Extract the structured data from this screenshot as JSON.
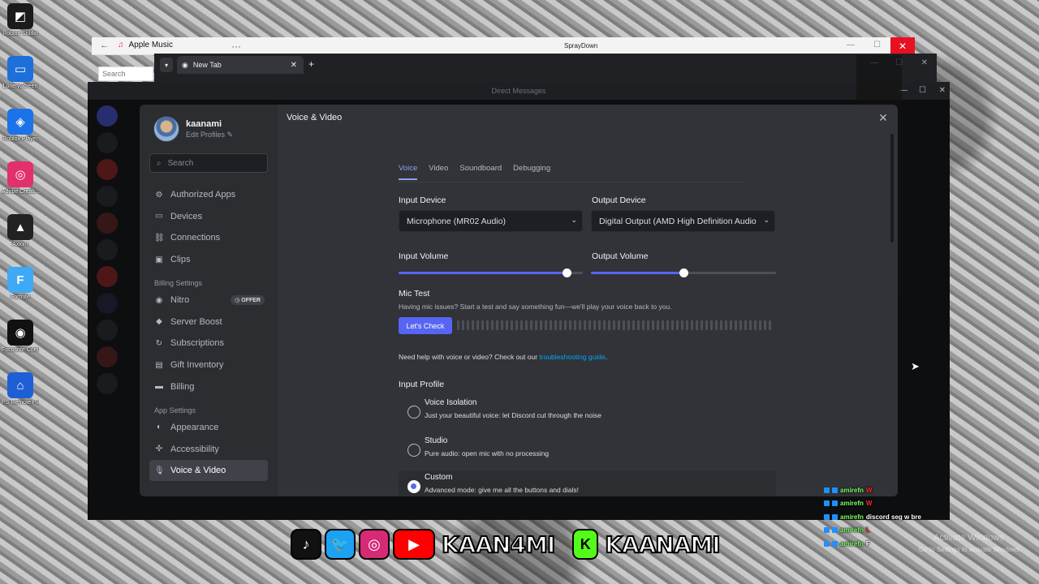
{
  "desktop": {
    "icons": [
      {
        "label": "Roblox Studio",
        "color": "#1b1b1b",
        "glyph": "◩"
      },
      {
        "label": "LonelyScreen",
        "color": "#1e6fd9",
        "glyph": "▭"
      },
      {
        "label": "Roblox Player",
        "color": "#1a73e8",
        "glyph": "◈"
      },
      {
        "label": "Adobe Creati...",
        "color": "#e1306c",
        "glyph": "◎"
      },
      {
        "label": "Axiom",
        "color": "#222222",
        "glyph": "▲"
      },
      {
        "label": "Fortnite",
        "color": "#3fa9f5",
        "glyph": "F"
      },
      {
        "label": "Focusrite Control",
        "color": "#111111",
        "glyph": "◉"
      },
      {
        "label": "PS Remote Play",
        "color": "#1f5fd6",
        "glyph": "⌂"
      }
    ]
  },
  "apple_music": {
    "title": "Apple Music",
    "search_placeholder": "Search",
    "center_text": "SprayDown"
  },
  "chrome": {
    "tab_label": "New Tab"
  },
  "discord": {
    "titlebar": "Direct Messages"
  },
  "settings": {
    "user": {
      "name": "kaanami",
      "edit": "Edit Profiles"
    },
    "search_placeholder": "Search",
    "nav_top": [
      {
        "label": "Authorized Apps",
        "icon": "⚙"
      },
      {
        "label": "Devices",
        "icon": "▭"
      },
      {
        "label": "Connections",
        "icon": "⛓"
      },
      {
        "label": "Clips",
        "icon": "▣"
      }
    ],
    "billing_head": "Billing Settings",
    "nav_billing": [
      {
        "label": "Nitro",
        "icon": "◉"
      },
      {
        "label": "Server Boost",
        "icon": "◆"
      },
      {
        "label": "Subscriptions",
        "icon": "↻"
      },
      {
        "label": "Gift Inventory",
        "icon": "▤"
      },
      {
        "label": "Billing",
        "icon": "▬"
      }
    ],
    "offer_badge": "OFFER",
    "app_head": "App Settings",
    "nav_app": [
      {
        "label": "Appearance",
        "icon": "◐"
      },
      {
        "label": "Accessibility",
        "icon": "✣"
      },
      {
        "label": "Voice & Video",
        "icon": "🎙"
      }
    ],
    "page_title": "Voice & Video",
    "tabs": [
      "Voice",
      "Video",
      "Soundboard",
      "Debugging"
    ],
    "input_device_label": "Input Device",
    "input_device_value": "Microphone (MR02 Audio)",
    "output_device_label": "Output Device",
    "output_device_value": "Digital Output (AMD High Definition Audio",
    "input_volume_label": "Input Volume",
    "input_volume": 0.91,
    "output_volume_label": "Output Volume",
    "output_volume": 0.5,
    "mic_test_title": "Mic Test",
    "mic_test_desc": "Having mic issues? Start a test and say something fun—we'll play your voice back to you.",
    "mic_test_button": "Let's Check",
    "help_text": "Need help with voice or video? Check out our ",
    "help_link": "troubleshooting guide",
    "help_end": ".",
    "input_profile_title": "Input Profile",
    "profiles": [
      {
        "title": "Voice Isolation",
        "sub": "Just your beautiful voice: let Discord cut through the noise"
      },
      {
        "title": "Studio",
        "sub": "Pure audio: open mic with no processing"
      },
      {
        "title": "Custom",
        "sub": "Advanced mode: give me all the buttons and dials!"
      }
    ]
  },
  "stream_chat": [
    {
      "user": "amirefn",
      "msg": "W"
    },
    {
      "user": "amirefn",
      "msg": "W"
    },
    {
      "user": "amirefn",
      "msg": "discord seg w bre"
    },
    {
      "user": "amirefn",
      "msg": "L"
    },
    {
      "user": "amirefn",
      "msg": "F"
    }
  ],
  "watermark": "Activate Windows",
  "watermark_sub": "Go to Settings to activate Windows.",
  "socials": {
    "handle1": "KAAN4MI",
    "handle2": "KAANAMI"
  }
}
